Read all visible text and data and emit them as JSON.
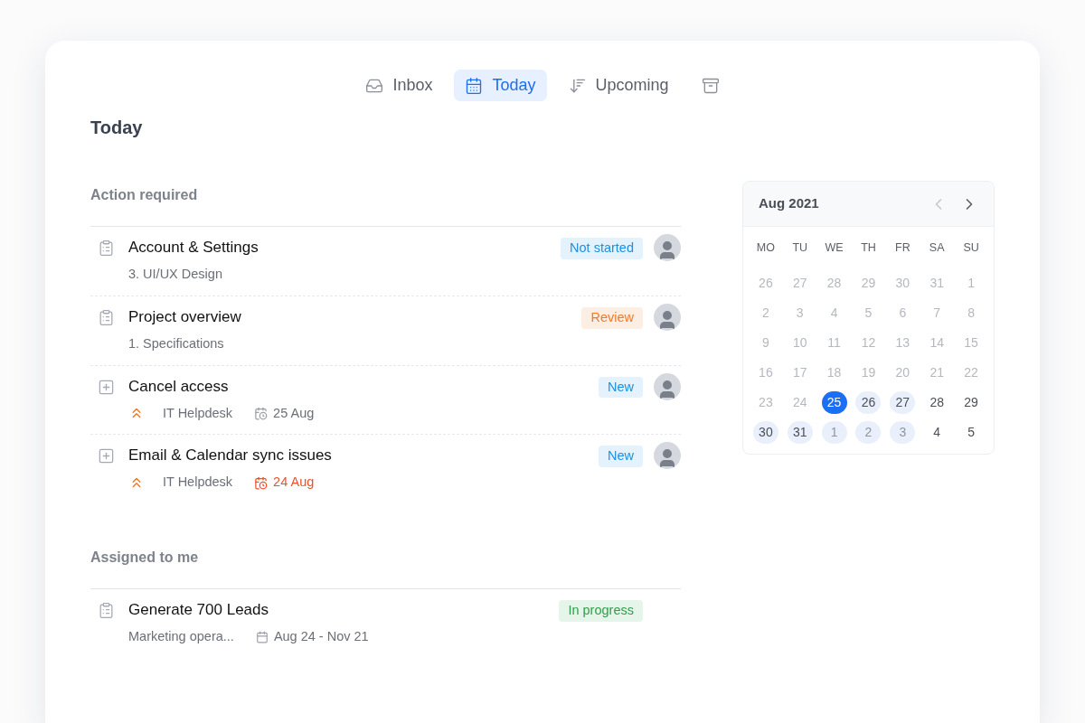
{
  "tabs": [
    {
      "kind": "inbox",
      "label": "Inbox",
      "selected": false
    },
    {
      "kind": "calendar",
      "label": "Today",
      "selected": true
    },
    {
      "kind": "sort",
      "label": "Upcoming",
      "selected": false
    },
    {
      "kind": "archive",
      "selected": false
    }
  ],
  "title": "Today",
  "sections": [
    {
      "heading": "Action required",
      "tasks": [
        {
          "kind": "clipboard",
          "title": "Account & Settings",
          "subtitle": "3. UI/UX Design",
          "status": {
            "label": "Not started",
            "kind": "info"
          },
          "has_avatar": true
        },
        {
          "kind": "clipboard",
          "title": "Project overview",
          "subtitle": "1. Specifications",
          "status": {
            "label": "Review",
            "kind": "warning"
          },
          "has_avatar": true
        },
        {
          "kind": "ticket",
          "title": "Cancel access",
          "subtitle": "IT Helpdesk",
          "priority": true,
          "due": "25 Aug",
          "overdue": false,
          "status": {
            "label": "New",
            "kind": "info"
          },
          "has_avatar": true
        },
        {
          "kind": "ticket",
          "title": "Email & Calendar sync issues",
          "subtitle": "IT Helpdesk",
          "priority": true,
          "due": "24 Aug",
          "overdue": true,
          "status": {
            "label": "New",
            "kind": "info"
          },
          "has_avatar": true
        }
      ]
    },
    {
      "heading": "Assigned to me",
      "tasks": [
        {
          "kind": "clipboard",
          "title": "Generate 700 Leads",
          "subtitle": "Marketing opera...",
          "range": "Aug 24 - Nov 21",
          "status": {
            "label": "In progress",
            "kind": "success"
          }
        }
      ]
    }
  ],
  "calendar": {
    "month": "Aug 2021",
    "weekdays": [
      "MO",
      "TU",
      "WE",
      "TH",
      "FR",
      "SA",
      "SU"
    ],
    "weeks": [
      [
        {
          "d": "26",
          "muted": true,
          "selected": false,
          "in_range": false
        },
        {
          "d": "27",
          "muted": true,
          "selected": false,
          "in_range": false
        },
        {
          "d": "28",
          "muted": true,
          "selected": false,
          "in_range": false
        },
        {
          "d": "29",
          "muted": true,
          "selected": false,
          "in_range": false
        },
        {
          "d": "30",
          "muted": true,
          "selected": false,
          "in_range": false
        },
        {
          "d": "31",
          "muted": true,
          "selected": false,
          "in_range": false
        },
        {
          "d": "1",
          "muted": true,
          "selected": false,
          "in_range": false
        }
      ],
      [
        {
          "d": "2",
          "muted": true,
          "selected": false,
          "in_range": false
        },
        {
          "d": "3",
          "muted": true,
          "selected": false,
          "in_range": false
        },
        {
          "d": "4",
          "muted": true,
          "selected": false,
          "in_range": false
        },
        {
          "d": "5",
          "muted": true,
          "selected": false,
          "in_range": false
        },
        {
          "d": "6",
          "muted": true,
          "selected": false,
          "in_range": false
        },
        {
          "d": "7",
          "muted": true,
          "selected": false,
          "in_range": false
        },
        {
          "d": "8",
          "muted": true,
          "selected": false,
          "in_range": false
        }
      ],
      [
        {
          "d": "9",
          "muted": true,
          "selected": false,
          "in_range": false
        },
        {
          "d": "10",
          "muted": true,
          "selected": false,
          "in_range": false
        },
        {
          "d": "11",
          "muted": true,
          "selected": false,
          "in_range": false
        },
        {
          "d": "12",
          "muted": true,
          "selected": false,
          "in_range": false
        },
        {
          "d": "13",
          "muted": true,
          "selected": false,
          "in_range": false
        },
        {
          "d": "14",
          "muted": true,
          "selected": false,
          "in_range": false
        },
        {
          "d": "15",
          "muted": true,
          "selected": false,
          "in_range": false
        }
      ],
      [
        {
          "d": "16",
          "muted": true,
          "selected": false,
          "in_range": false
        },
        {
          "d": "17",
          "muted": true,
          "selected": false,
          "in_range": false
        },
        {
          "d": "18",
          "muted": true,
          "selected": false,
          "in_range": false
        },
        {
          "d": "19",
          "muted": true,
          "selected": false,
          "in_range": false
        },
        {
          "d": "20",
          "muted": true,
          "selected": false,
          "in_range": false
        },
        {
          "d": "21",
          "muted": true,
          "selected": false,
          "in_range": false
        },
        {
          "d": "22",
          "muted": true,
          "selected": false,
          "in_range": false
        }
      ],
      [
        {
          "d": "23",
          "muted": true,
          "selected": false,
          "in_range": false
        },
        {
          "d": "24",
          "muted": true,
          "selected": false,
          "in_range": false
        },
        {
          "d": "25",
          "muted": false,
          "selected": true,
          "in_range": false
        },
        {
          "d": "26",
          "muted": false,
          "selected": false,
          "in_range": true
        },
        {
          "d": "27",
          "muted": false,
          "selected": false,
          "in_range": true
        },
        {
          "d": "28",
          "muted": false,
          "selected": false,
          "in_range": false
        },
        {
          "d": "29",
          "muted": false,
          "selected": false,
          "in_range": false
        }
      ],
      [
        {
          "d": "30",
          "muted": false,
          "selected": false,
          "in_range": true
        },
        {
          "d": "31",
          "muted": false,
          "selected": false,
          "in_range": true
        },
        {
          "d": "1",
          "muted": true,
          "selected": false,
          "in_range": true
        },
        {
          "d": "2",
          "muted": true,
          "selected": false,
          "in_range": true
        },
        {
          "d": "3",
          "muted": true,
          "selected": false,
          "in_range": true
        },
        {
          "d": "4",
          "muted": false,
          "selected": false,
          "in_range": false
        },
        {
          "d": "5",
          "muted": false,
          "selected": false,
          "in_range": false
        }
      ]
    ]
  }
}
